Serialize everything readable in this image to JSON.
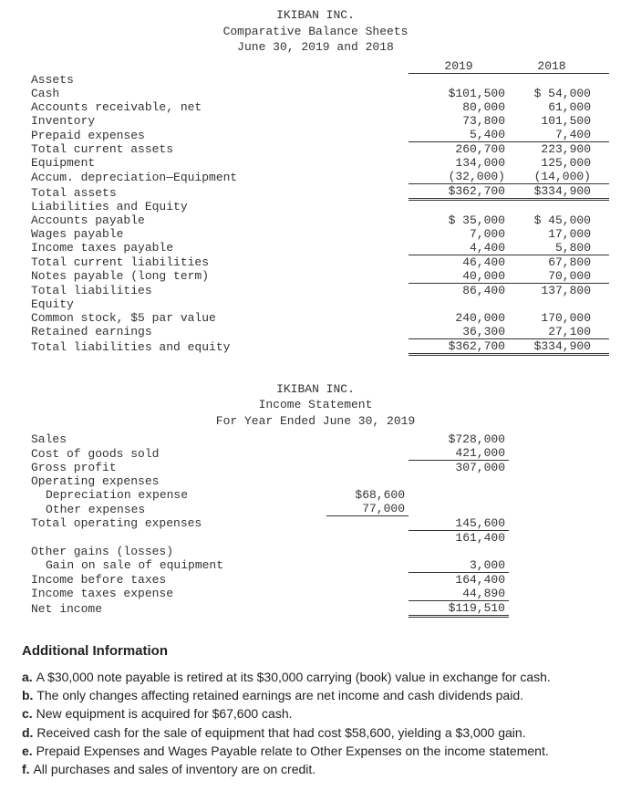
{
  "balance_sheet": {
    "company": "IKIBAN INC.",
    "title": "Comparative Balance Sheets",
    "date_line": "June 30, 2019 and 2018",
    "col_headers": [
      "2019",
      "2018"
    ],
    "section_assets": "Assets",
    "rows_assets": [
      {
        "label": "Cash",
        "y19": "$101,500",
        "y18": "$ 54,000"
      },
      {
        "label": "Accounts receivable, net",
        "y19": "80,000",
        "y18": "61,000"
      },
      {
        "label": "Inventory",
        "y19": "73,800",
        "y18": "101,500"
      },
      {
        "label": "Prepaid expenses",
        "y19": "5,400",
        "y18": "7,400",
        "sub_underline": true
      },
      {
        "label": "Total current assets",
        "y19": "260,700",
        "y18": "223,900"
      },
      {
        "label": "Equipment",
        "y19": "134,000",
        "y18": "125,000"
      },
      {
        "label": "Accum. depreciation—Equipment",
        "y19": "(32,000)",
        "y18": "(14,000)",
        "sub_underline": true
      },
      {
        "label": "Total assets",
        "y19": "$362,700",
        "y18": "$334,900",
        "total_dbl": true
      }
    ],
    "section_liab": "Liabilities and Equity",
    "rows_liab": [
      {
        "label": "Accounts payable",
        "y19": "$ 35,000",
        "y18": "$ 45,000"
      },
      {
        "label": "Wages payable",
        "y19": "7,000",
        "y18": "17,000"
      },
      {
        "label": "Income taxes payable",
        "y19": "4,400",
        "y18": "5,800",
        "sub_underline": true
      },
      {
        "label": "Total current liabilities",
        "y19": "46,400",
        "y18": "67,800"
      },
      {
        "label": "Notes payable (long term)",
        "y19": "40,000",
        "y18": "70,000",
        "sub_underline": true
      },
      {
        "label": "Total liabilities",
        "y19": "86,400",
        "y18": "137,800"
      }
    ],
    "section_equity": "Equity",
    "rows_equity": [
      {
        "label": "Common stock, $5 par value",
        "y19": "240,000",
        "y18": "170,000"
      },
      {
        "label": "Retained earnings",
        "y19": "36,300",
        "y18": "27,100",
        "sub_underline": true
      },
      {
        "label": "Total liabilities and equity",
        "y19": "$362,700",
        "y18": "$334,900",
        "total_dbl": true
      }
    ]
  },
  "income_statement": {
    "company": "IKIBAN INC.",
    "title": "Income Statement",
    "date_line": "For Year Ended June 30, 2019",
    "rows": [
      {
        "label": "Sales",
        "amt": "$728,000"
      },
      {
        "label": "Cost of goods sold",
        "amt": "421,000",
        "sub_underline": true
      },
      {
        "label": "Gross profit",
        "amt": "307,000"
      },
      {
        "label": "Operating expenses"
      },
      {
        "label": "Depreciation expense",
        "indent": true,
        "sub": "$68,600"
      },
      {
        "label": "Other expenses",
        "indent": true,
        "sub": "77,000",
        "sub_subline": true
      },
      {
        "label": "Total operating expenses",
        "amt": "145,600",
        "sub_underline": true
      },
      {
        "label": "",
        "amt": "161,400"
      },
      {
        "label": "Other gains (losses)"
      },
      {
        "label": "Gain on sale of equipment",
        "indent": true,
        "amt": "3,000",
        "sub_underline": true
      },
      {
        "label": "Income before taxes",
        "amt": "164,400"
      },
      {
        "label": "Income taxes expense",
        "amt": "44,890",
        "sub_underline": true
      },
      {
        "label": "Net income",
        "amt": "$119,510",
        "total_dbl": true
      }
    ]
  },
  "additional": {
    "title": "Additional Information",
    "items": [
      {
        "tag": "a.",
        "text": "A $30,000 note payable is retired at its $30,000 carrying (book) value in exchange for cash."
      },
      {
        "tag": "b.",
        "text": "The only changes affecting retained earnings are net income and cash dividends paid."
      },
      {
        "tag": "c.",
        "text": "New equipment is acquired for $67,600 cash."
      },
      {
        "tag": "d.",
        "text": "Received cash for the sale of equipment that had cost $58,600, yielding a $3,000 gain."
      },
      {
        "tag": "e.",
        "text": "Prepaid Expenses and Wages Payable relate to Other Expenses on the income statement."
      },
      {
        "tag": "f.",
        "text": "All purchases and sales of inventory are on credit."
      }
    ]
  }
}
